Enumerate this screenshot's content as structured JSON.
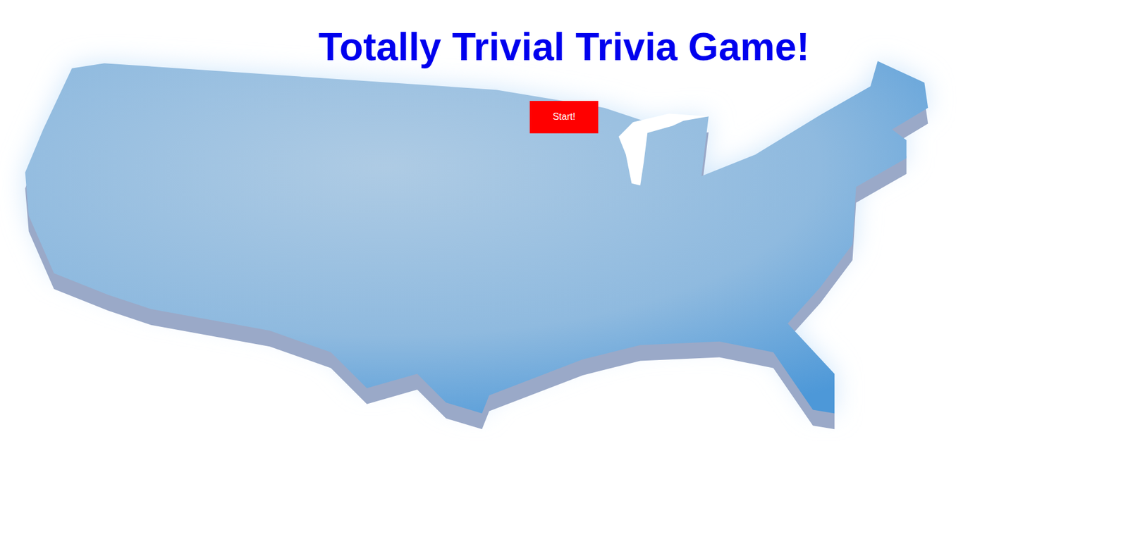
{
  "title": "Totally Trivial Trivia Game!",
  "start_button": {
    "label": "Start!"
  }
}
